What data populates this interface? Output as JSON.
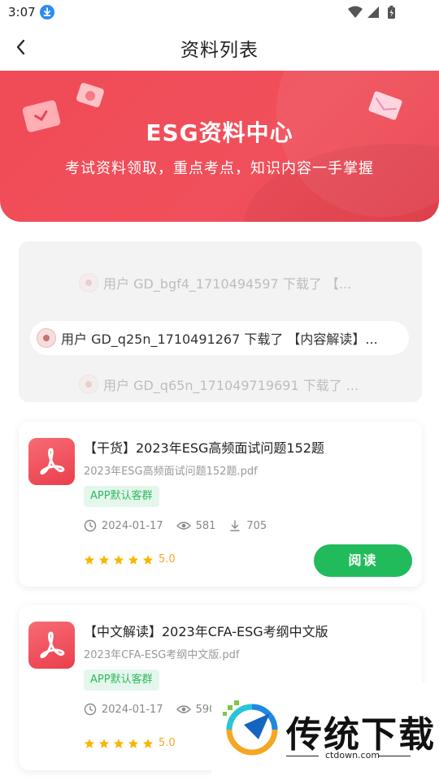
{
  "status_bar": {
    "time": "3:07"
  },
  "nav": {
    "title": "资料列表"
  },
  "banner": {
    "title": "ESG资料中心",
    "subtitle": "考试资料领取，重点考点，知识内容一手掌握"
  },
  "ticker": [
    {
      "text": "用户 GD_bgf4_1710494597 下载了 【..."
    },
    {
      "text": "用户 GD_q25n_1710491267 下载了 【内容解读】..."
    },
    {
      "text": "用户 GD_q65n_171049719691 下载了 ..."
    }
  ],
  "cards": [
    {
      "title": "【干货】2023年ESG高频面试问题152题",
      "file": "2023年ESG高频面试问题152题.pdf",
      "tag": "APP默认客群",
      "date": "2024-01-17",
      "views": "581",
      "downloads": "705",
      "rating": "5.0",
      "read_label": "阅读"
    },
    {
      "title": "【中文解读】2023年CFA-ESG考纲中文版",
      "file": "2023年CFA-ESG考纲中文版.pdf",
      "tag": "APP默认客群",
      "date": "2024-01-17",
      "views": "590",
      "rating": "5.0"
    }
  ],
  "watermark": {
    "text": "传统下载",
    "url": "ctdown.com"
  },
  "colors": {
    "accent_red": "#f04b57",
    "read_green": "#22bb5c",
    "tag_green": "#2fb95f",
    "star": "#f5b800"
  }
}
